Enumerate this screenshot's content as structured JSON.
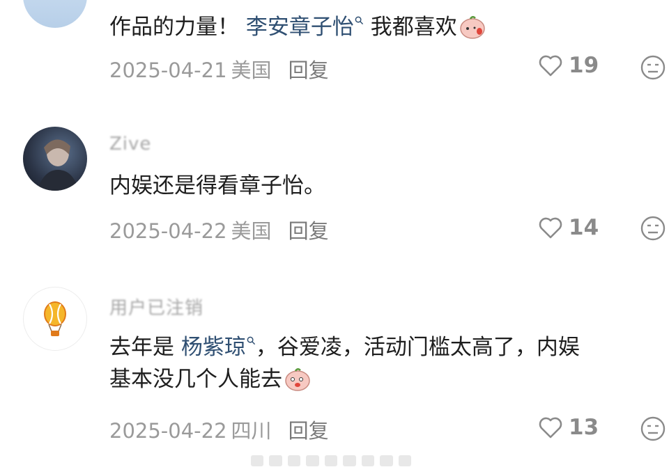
{
  "comments": [
    {
      "username": "",
      "text_before": "作品的力量！ ",
      "mention": "李安章子怡",
      "text_after": " 我都喜欢",
      "text_line2": "",
      "date": "2025-04-21",
      "location": "美国",
      "reply_label": "回复",
      "likes": "19",
      "has_emoji": true
    },
    {
      "username": "Zive",
      "text_before": "内娱还是得看章子怡。",
      "mention": "",
      "text_after": "",
      "text_line2": "",
      "date": "2025-04-22",
      "location": "美国",
      "reply_label": "回复",
      "likes": "14",
      "has_emoji": false
    },
    {
      "username": "用户已注销",
      "text_before": "去年是 ",
      "mention": "杨紫琼",
      "text_after": "，谷爱凌，活动门槛太高了，内娱",
      "text_line2": "基本没几个人能去",
      "date": "2025-04-22",
      "location": "四川",
      "reply_label": "回复",
      "likes": "13",
      "has_emoji": true
    }
  ],
  "colors": {
    "mention": "#2f4f72",
    "meta": "#9a9a9a",
    "text": "#1e1e1e"
  },
  "icons": [
    "heart-icon",
    "dislike-face-icon",
    "search-icon",
    "hot-air-balloon-icon",
    "peach-emoji-icon"
  ]
}
